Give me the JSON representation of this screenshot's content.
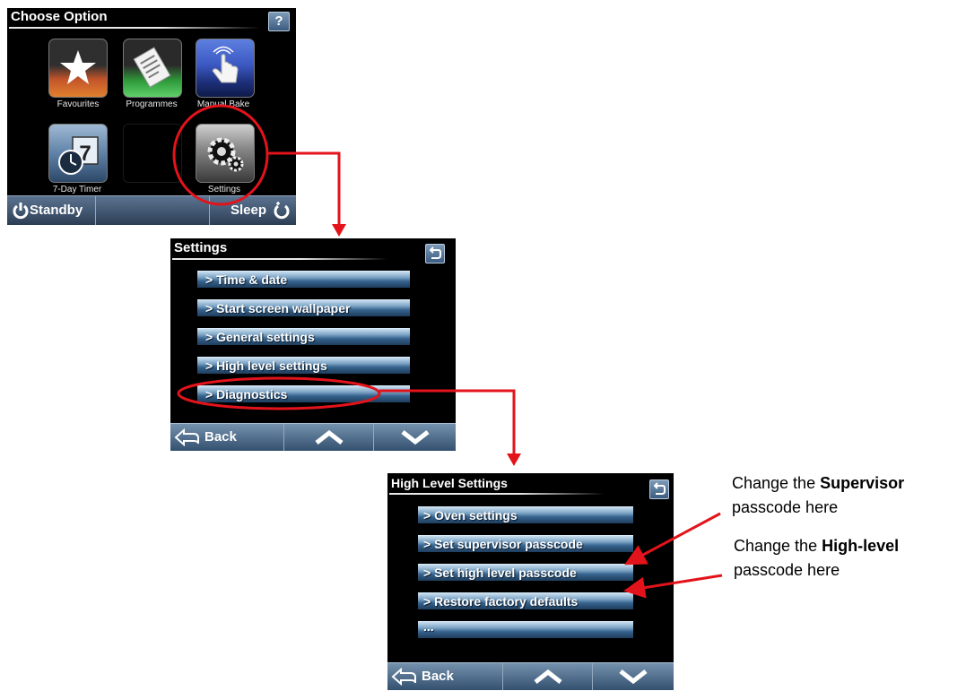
{
  "screen1": {
    "title": "Choose Option",
    "help_label": "?",
    "tiles": [
      {
        "label": "Favourites",
        "icon": "star-icon"
      },
      {
        "label": "Programmes",
        "icon": "document-icon"
      },
      {
        "label": "Manual Bake",
        "icon": "hand-pointer-icon"
      },
      {
        "label": "7-Day Timer",
        "icon": "clock-calendar-icon"
      },
      {
        "label": "Settings",
        "icon": "gears-icon"
      }
    ],
    "standby_label": "Standby",
    "sleep_label": "Sleep"
  },
  "screen2": {
    "title": "Settings",
    "items": [
      "> Time & date",
      "> Start screen wallpaper",
      "> General settings",
      "> High level settings",
      "> Diagnostics"
    ],
    "back_label": "Back"
  },
  "screen3": {
    "title": "High Level Settings",
    "items": [
      "> Oven settings",
      "> Set supervisor passcode",
      "> Set high level passcode",
      "> Restore factory defaults",
      "..."
    ],
    "back_label": "Back"
  },
  "callouts": {
    "supervisor": {
      "prefix": "Change the ",
      "bold": "Supervisor",
      "suffix": "passcode here"
    },
    "high_level": {
      "prefix": "Change the ",
      "bold": "High-level",
      "suffix": "passcode here"
    }
  },
  "colors": {
    "highlight_red": "#e3131b",
    "screen_bg": "#000000",
    "menu_blue": "#36638e"
  }
}
